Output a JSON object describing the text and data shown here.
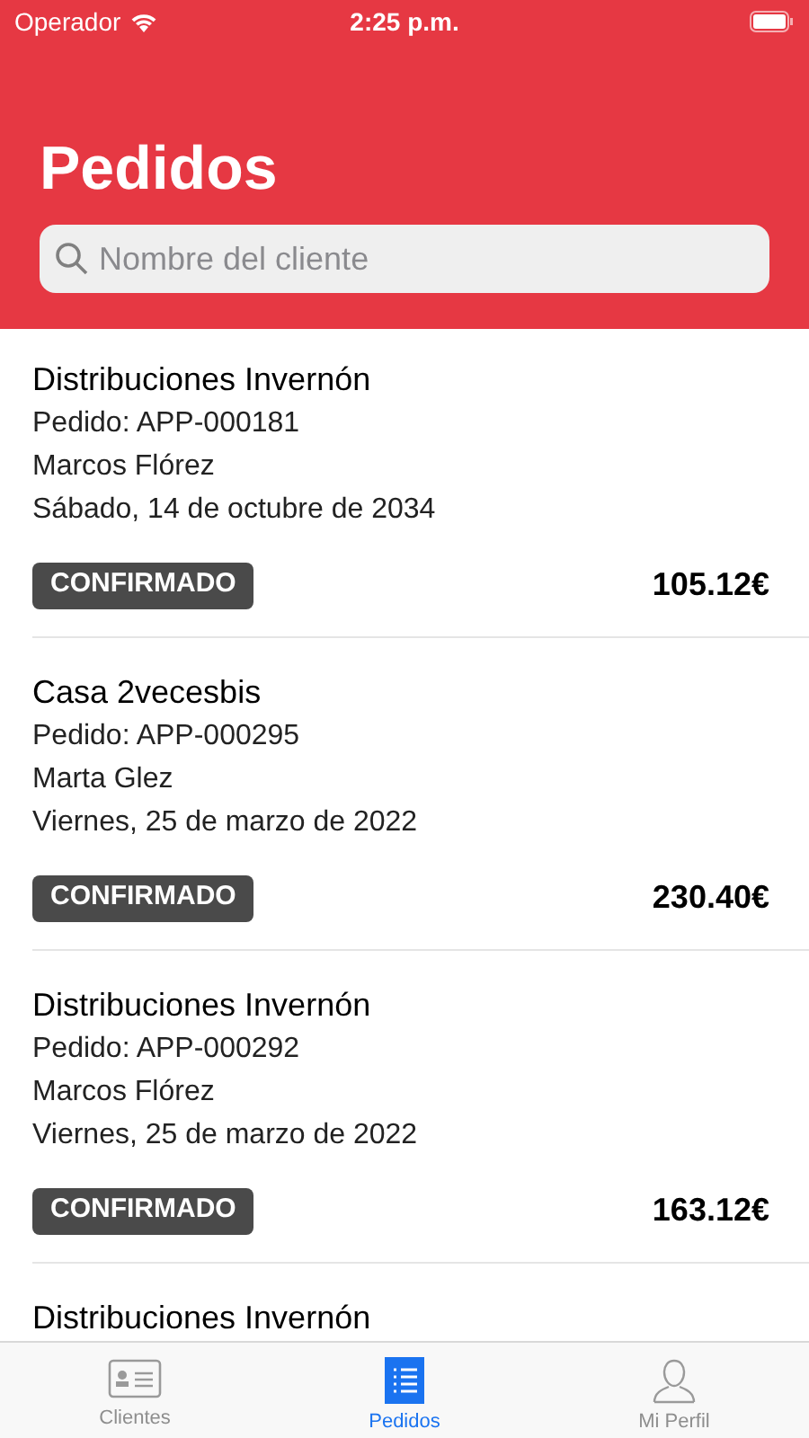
{
  "status_bar": {
    "carrier": "Operador",
    "time": "2:25 p.m."
  },
  "title": "Pedidos",
  "search": {
    "placeholder": "Nombre del cliente"
  },
  "orders": [
    {
      "client": "Distribuciones Invernón",
      "order": "Pedido: APP-000181",
      "person": "Marcos Flórez",
      "date": "Sábado, 14 de octubre de 2034",
      "status": "CONFIRMADO",
      "total": "105.12€"
    },
    {
      "client": "Casa 2vecesbis",
      "order": "Pedido: APP-000295",
      "person": "Marta Glez",
      "date": "Viernes, 25 de marzo de 2022",
      "status": "CONFIRMADO",
      "total": "230.40€"
    },
    {
      "client": "Distribuciones Invernón",
      "order": "Pedido: APP-000292",
      "person": "Marcos Flórez",
      "date": "Viernes, 25 de marzo de 2022",
      "status": "CONFIRMADO",
      "total": "163.12€"
    },
    {
      "client": "Distribuciones Invernón"
    }
  ],
  "tab_bar": [
    {
      "kind": "clients",
      "label": "Clientes",
      "selected": false
    },
    {
      "kind": "orders",
      "label": "Pedidos",
      "selected": true
    },
    {
      "kind": "profile",
      "label": "Mi Perfil",
      "selected": false
    }
  ]
}
